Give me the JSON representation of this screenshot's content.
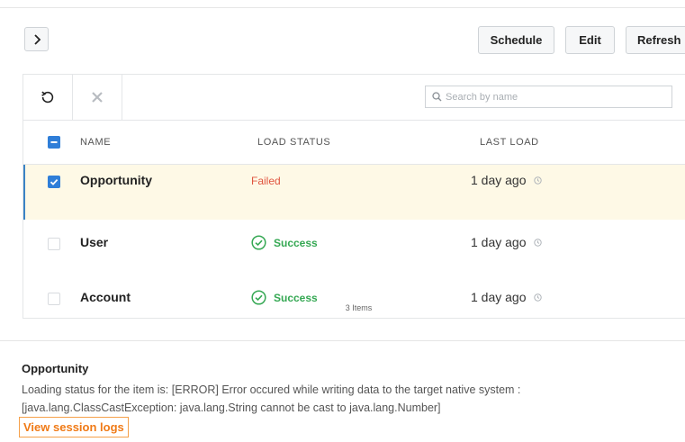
{
  "header": {
    "expand_glyph": "›",
    "schedule_label": "Schedule",
    "edit_label": "Edit",
    "refresh_label": "Refresh"
  },
  "toolbar": {
    "search_placeholder": "Search by name",
    "icons": [
      "refresh-icon",
      "delete-icon",
      "search-icon"
    ]
  },
  "table": {
    "columns": [
      "NAME",
      "LOAD STATUS",
      "LAST LOAD"
    ],
    "rows": [
      {
        "name": "Opportunity",
        "status": "Failed",
        "last_load": "1 day ago",
        "selected": true
      },
      {
        "name": "User",
        "status": "Success",
        "last_load": "1 day ago",
        "selected": false
      },
      {
        "name": "Account",
        "status": "Success",
        "last_load": "1 day ago",
        "selected": false
      }
    ],
    "count": "3 Items"
  },
  "details": {
    "title": "Opportunity",
    "message": "Loading status for the item is: [ERROR] Error occured while writing data to the target native system : [java.lang.ClassCastException: java.lang.String cannot be cast to java.lang.Number]",
    "logs_link": "View session logs"
  },
  "colors": {
    "accent_blue": "#2f7ed8",
    "failed": "#e0553f",
    "success": "#35a853",
    "selected_row_bg": "#fef9e6",
    "link": "#f07a16"
  }
}
